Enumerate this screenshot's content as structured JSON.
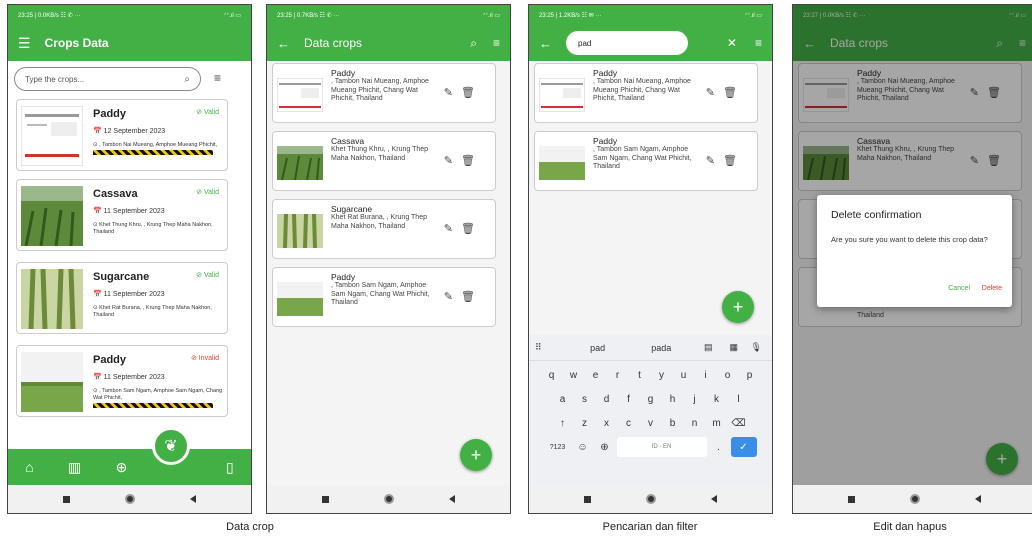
{
  "captions": [
    "Data crop",
    "Pencarian dan filter",
    "Edit dan hapus"
  ],
  "colors": {
    "primary": "#43b046",
    "valid": "#43b046",
    "invalid": "#e53935"
  },
  "screen1": {
    "status_left": "23:25 | 0.0KB/s ☷ ✆ ···",
    "status_right": "ᐟᐟ.ıl ▭",
    "title": "Crops Data",
    "search_placeholder": "Type the crops...",
    "cards": [
      {
        "name": "Paddy",
        "status": "Valid",
        "date": "12 September 2023",
        "address": ", Tambon Nai Mueang, Amphoe Mueang Phichit,"
      },
      {
        "name": "Cassava",
        "status": "Valid",
        "date": "11 September 2023",
        "address": "Khet Thung Khru, , Krung Thep Maha Nakhon, Thailand"
      },
      {
        "name": "Sugarcane",
        "status": "Valid",
        "date": "11 September 2023",
        "address": "Khet Rat Burana, , Krung Thep Maha Nakhon, Thailand"
      },
      {
        "name": "Paddy",
        "status": "Invalid",
        "date": "11 September 2023",
        "address": ", Tambon Sam Ngam, Amphoe Sam Ngam, Chang Wat Phichit,"
      }
    ]
  },
  "screen2": {
    "status_left": "23:25 | 0.7KB/s ☷ ✆ ···",
    "status_right": "ᐟᐟ.ıl ▭",
    "title": "Data crops",
    "cards": [
      {
        "name": "Paddy",
        "address": ", Tambon Nai Mueang, Amphoe Mueang Phichit, Chang Wat Phichit, Thailand"
      },
      {
        "name": "Cassava",
        "address": "Khet Thung Khru, , Krung Thep Maha Nakhon, Thailand"
      },
      {
        "name": "Sugarcane",
        "address": "Khet Rat Burana, , Krung Thep Maha Nakhon, Thailand"
      },
      {
        "name": "Paddy",
        "address": ", Tambon Sam Ngam, Amphoe Sam Ngam, Chang Wat Phichit, Thailand"
      }
    ]
  },
  "screen3": {
    "status_left": "23:25 | 1.2KB/s ☷ ✉ ···",
    "status_right": "ᐟᐟ.ıl ▭",
    "search_value": "pad",
    "cards": [
      {
        "name": "Paddy",
        "address": ", Tambon Nai Mueang, Amphoe Mueang Phichit, Chang Wat Phichit, Thailand"
      },
      {
        "name": "Paddy",
        "address": ", Tambon Sam Ngam, Amphoe Sam Ngam, Chang Wat Phichit, Thailand"
      }
    ],
    "suggestions": [
      "pad",
      "pada"
    ],
    "keyboard_rows": [
      [
        "q",
        "w",
        "e",
        "r",
        "t",
        "y",
        "u",
        "i",
        "o",
        "p"
      ],
      [
        "a",
        "s",
        "d",
        "f",
        "g",
        "h",
        "j",
        "k",
        "l"
      ],
      [
        "↑",
        "z",
        "x",
        "c",
        "v",
        "b",
        "n",
        "m",
        "⌫"
      ]
    ],
    "space_label": "ID · EN",
    "num_key": "?123"
  },
  "screen4": {
    "status_left": "23:27 | 0.0KB/s ☷ ✆ ···",
    "status_right": "ᐟᐟ.ıl ▭",
    "title": "Data crops",
    "cards": [
      {
        "name": "Paddy",
        "address": ", Tambon Nai Mueang, Amphoe Mueang Phichit, Chang Wat Phichit, Thailand"
      },
      {
        "name": "Cassava",
        "address": "Khet Thung Khru, , Krung Thep Maha Nakhon, Thailand"
      }
    ],
    "partial_address": "Thailand",
    "dialog": {
      "title": "Delete confirmation",
      "message": "Are you sure you want to delete this crop data?",
      "cancel": "Cancel",
      "delete": "Delete"
    }
  }
}
